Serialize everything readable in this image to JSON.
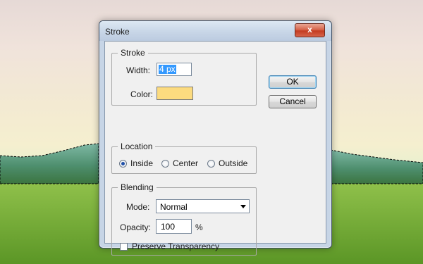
{
  "dialog": {
    "title": "Stroke",
    "close_icon_glyph": "x",
    "buttons": {
      "ok": "OK",
      "cancel": "Cancel"
    }
  },
  "stroke": {
    "legend": "Stroke",
    "width_label": "Width:",
    "width_value": "4 px",
    "color_label": "Color:",
    "color_value": "#fcdb7f"
  },
  "location": {
    "legend": "Location",
    "options": [
      "Inside",
      "Center",
      "Outside"
    ],
    "selected": "Inside"
  },
  "blending": {
    "legend": "Blending",
    "mode_label": "Mode:",
    "mode_value": "Normal",
    "opacity_label": "Opacity:",
    "opacity_value": "100",
    "opacity_unit": "%",
    "preserve_label": "Preserve Transparency",
    "preserve_checked": false
  },
  "colors": {
    "accent": "#3c7fb1",
    "selection": "#3399ff"
  }
}
